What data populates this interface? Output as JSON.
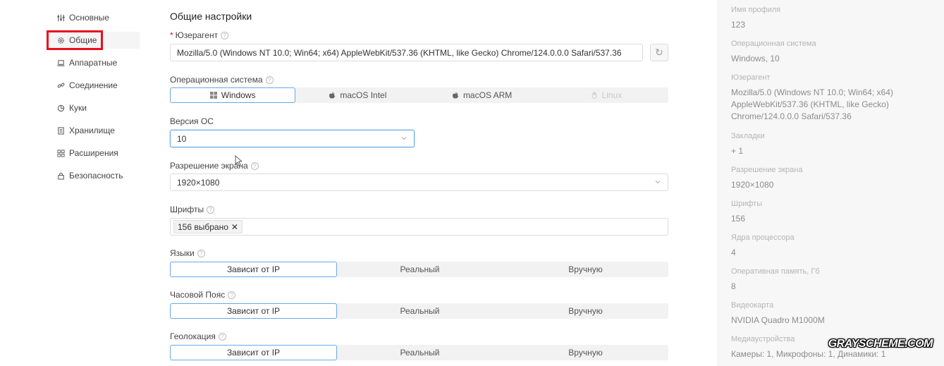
{
  "sidebar": {
    "items": [
      {
        "label": "Основные",
        "icon": "sliders-icon"
      },
      {
        "label": "Общие",
        "icon": "gear-icon"
      },
      {
        "label": "Аппаратные",
        "icon": "laptop-icon"
      },
      {
        "label": "Соединение",
        "icon": "link-icon"
      },
      {
        "label": "Куки",
        "icon": "pie-icon"
      },
      {
        "label": "Хранилище",
        "icon": "storage-icon"
      },
      {
        "label": "Расширения",
        "icon": "grid-icon"
      },
      {
        "label": "Безопасность",
        "icon": "lock-icon"
      }
    ]
  },
  "main": {
    "title": "Общие настройки",
    "useragent": {
      "label": "Юзерагент",
      "value": "Mozilla/5.0 (Windows NT 10.0; Win64; x64) AppleWebKit/537.36 (KHTML, like Gecko) Chrome/124.0.0.0 Safari/537.36"
    },
    "os": {
      "label": "Операционная система",
      "options": [
        "Windows",
        "macOS Intel",
        "macOS ARM",
        "Linux"
      ]
    },
    "os_version": {
      "label": "Версия ОС",
      "value": "10"
    },
    "resolution": {
      "label": "Разрешение экрана",
      "value": "1920×1080"
    },
    "fonts": {
      "label": "Шрифты",
      "tag": "156 выбрано"
    },
    "languages": {
      "label": "Языки",
      "options": [
        "Зависит от IP",
        "Реальный",
        "Вручную"
      ]
    },
    "timezone": {
      "label": "Часовой Пояс",
      "options": [
        "Зависит от IP",
        "Реальный",
        "Вручную"
      ]
    },
    "geolocation": {
      "label": "Геолокация",
      "options": [
        "Зависит от IP",
        "Реальный",
        "Вручную"
      ]
    }
  },
  "panel": {
    "items": [
      {
        "label": "Имя профиля",
        "value": "123"
      },
      {
        "label": "Операционная система",
        "value": "Windows, 10"
      },
      {
        "label": "Юзерагент",
        "value": "Mozilla/5.0 (Windows NT 10.0; Win64; x64) AppleWebKit/537.36 (KHTML, like Gecko) Chrome/124.0.0.0 Safari/537.36"
      },
      {
        "label": "Закладки",
        "value": "+ 1"
      },
      {
        "label": "Разрешение экрана",
        "value": "1920×1080"
      },
      {
        "label": "Шрифты",
        "value": "156"
      },
      {
        "label": "Ядра процессора",
        "value": "4"
      },
      {
        "label": "Оперативная память, Гб",
        "value": "8"
      },
      {
        "label": "Видеокарта",
        "value": "NVIDIA Quadro M1000M"
      },
      {
        "label": "Медиаустройства",
        "value": "Камеры: 1, Микрофоны: 1, Динамики: 1"
      }
    ]
  },
  "watermark": "GRAYSCHEME.COM",
  "colors": {
    "accent": "#6aa8e8",
    "highlight": "#e8101e",
    "panel_bg": "#f7f7f7"
  }
}
